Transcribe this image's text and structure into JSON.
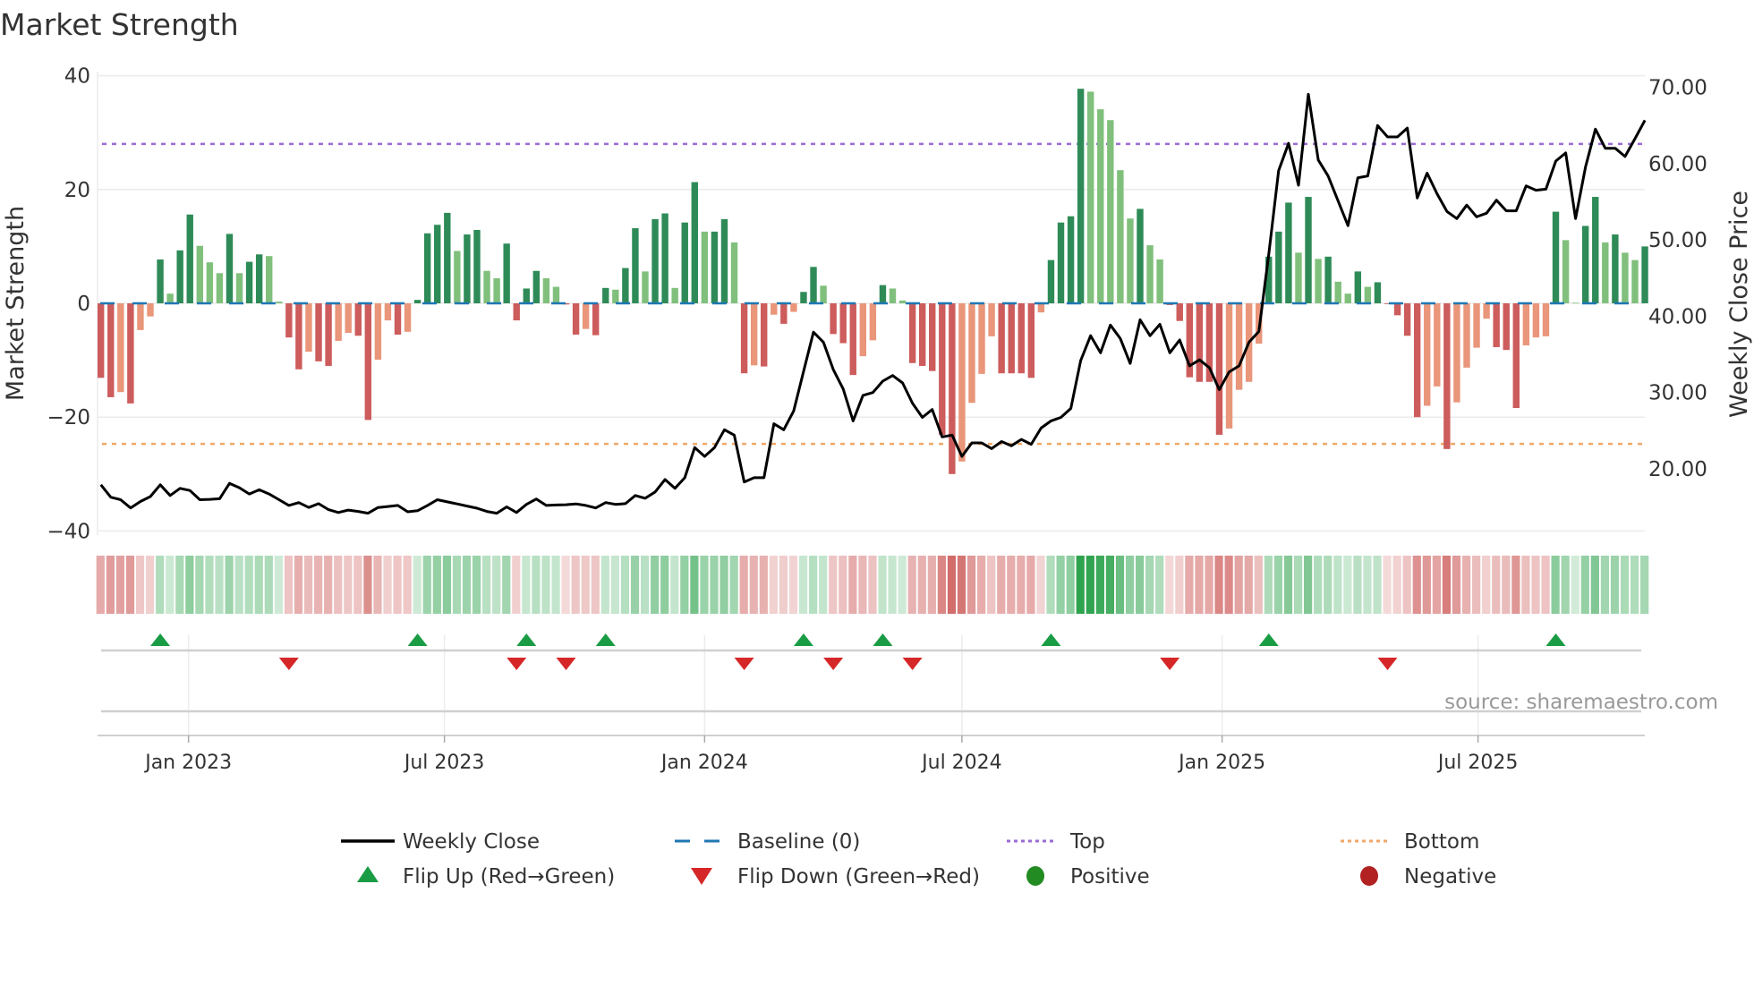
{
  "chart_data": {
    "type": "bar",
    "title": "Market Strength",
    "ylabel": "Market Strength",
    "y2label": "Weekly Close Price",
    "ylim": [
      -40,
      40
    ],
    "y2lim": [
      10.0,
      72.0
    ],
    "yticks": [
      "40",
      "20",
      "0",
      "−20",
      "−40"
    ],
    "ytick_values": [
      40,
      20,
      0,
      -20,
      -40
    ],
    "y2ticks": [
      "70.00",
      "60.00",
      "50.00",
      "40.00",
      "30.00",
      "20.00"
    ],
    "y2tick_values": [
      70,
      60,
      50,
      40,
      30,
      20
    ],
    "x_start": "2022-10-31",
    "x_step_days": 7,
    "xticks": [
      {
        "label": "Jan 2023",
        "date": "2023-01-01"
      },
      {
        "label": "Jul 2023",
        "date": "2023-07-01"
      },
      {
        "label": "Jan 2024",
        "date": "2024-01-01"
      },
      {
        "label": "Jul 2024",
        "date": "2024-07-01"
      },
      {
        "label": "Jan 2025",
        "date": "2025-01-01"
      },
      {
        "label": "Jul 2025",
        "date": "2025-07-01"
      }
    ],
    "top_level": 28,
    "bottom_level": -24.7,
    "baseline": 0,
    "strength": [
      -13.1,
      -16.5,
      -15.6,
      -17.6,
      -4.7,
      -2.3,
      7.7,
      1.7,
      9.3,
      15.6,
      10.1,
      7.2,
      5.3,
      12.2,
      5.3,
      7.3,
      8.6,
      8.3,
      0.3,
      -6.0,
      -11.6,
      -8.5,
      -10.2,
      -11.0,
      -6.6,
      -5.2,
      -5.7,
      -20.5,
      -9.9,
      -3.0,
      -5.5,
      -5.0,
      0.6,
      12.3,
      13.8,
      15.9,
      9.2,
      12.1,
      12.9,
      5.7,
      4.4,
      10.5,
      -3.0,
      2.6,
      5.7,
      4.4,
      2.9,
      -0.2,
      -5.5,
      -4.5,
      -5.6,
      2.7,
      2.4,
      6.2,
      13.2,
      5.6,
      14.8,
      15.8,
      2.7,
      14.2,
      21.3,
      12.6,
      12.6,
      14.8,
      10.7,
      -12.3,
      -10.9,
      -11.1,
      -2.0,
      -3.6,
      -1.5,
      2.0,
      6.4,
      3.1,
      -5.4,
      -7.0,
      -12.6,
      -9.3,
      -6.5,
      3.2,
      2.6,
      0.5,
      -10.5,
      -11.0,
      -11.9,
      -23.1,
      -30.0,
      -27.8,
      -17.5,
      -12.4,
      -5.8,
      -12.3,
      -12.3,
      -12.3,
      -13.1,
      -1.6,
      7.6,
      14.2,
      15.3,
      37.7,
      37.2,
      34.1,
      32.2,
      23.4,
      14.9,
      16.6,
      10.2,
      7.7,
      -0.3,
      -3.1,
      -13.0,
      -13.8,
      -13.8,
      -23.1,
      -22.0,
      -15.2,
      -13.8,
      -7.1,
      8.2,
      12.6,
      17.7,
      8.9,
      18.7,
      7.8,
      8.2,
      3.8,
      1.7,
      5.6,
      2.9,
      3.7,
      -0.1,
      -2.1,
      -5.7,
      -20.0,
      -18.0,
      -14.6,
      -25.6,
      -17.4,
      -11.3,
      -7.8,
      -2.7,
      -7.7,
      -8.2,
      -18.4,
      -7.4,
      -6.0,
      -5.8,
      16.1,
      11.1,
      0.1,
      13.6,
      18.7,
      10.7,
      12.1,
      8.9,
      7.6,
      10.0
    ],
    "weekly_close": [
      17.91,
      16.28,
      15.95,
      14.88,
      15.72,
      16.37,
      17.91,
      16.51,
      17.44,
      17.16,
      15.95,
      16.0,
      16.09,
      18.1,
      17.53,
      16.7,
      17.26,
      16.7,
      15.95,
      15.21,
      15.58,
      14.93,
      15.44,
      14.65,
      14.28,
      14.6,
      14.42,
      14.19,
      14.93,
      15.07,
      15.21,
      14.37,
      14.51,
      15.21,
      15.95,
      15.67,
      15.4,
      15.12,
      14.84,
      14.42,
      14.19,
      15.02,
      14.28,
      15.35,
      16.05,
      15.21,
      15.26,
      15.3,
      15.4,
      15.21,
      14.88,
      15.58,
      15.35,
      15.44,
      16.51,
      16.14,
      16.98,
      18.6,
      17.44,
      18.84,
      22.79,
      21.63,
      22.79,
      25.12,
      24.42,
      18.28,
      18.84,
      18.84,
      25.91,
      25.12,
      27.58,
      32.79,
      37.91,
      36.6,
      33.02,
      30.47,
      26.28,
      29.63,
      30.0,
      31.49,
      32.23,
      31.26,
      28.6,
      26.74,
      27.77,
      24.19,
      24.42,
      21.63,
      23.4,
      23.4,
      22.65,
      23.58,
      23.02,
      23.86,
      23.21,
      25.35,
      26.28,
      26.74,
      27.91,
      34.19,
      37.44,
      35.21,
      38.84,
      37.07,
      33.81,
      39.53,
      37.44,
      38.93,
      35.21,
      36.88,
      33.49,
      34.28,
      33.26,
      30.37,
      32.7,
      33.49,
      36.6,
      38.0,
      48.14,
      59.07,
      62.65,
      57.16,
      69.07,
      60.47,
      58.37,
      55.12,
      51.86,
      58.14,
      58.37,
      64.98,
      63.49,
      63.49,
      64.65,
      55.49,
      58.74,
      56.05,
      53.72,
      52.79,
      54.56,
      53.02,
      53.49,
      55.21,
      53.81,
      53.81,
      57.07,
      56.51,
      56.65,
      60.33,
      61.4,
      52.79,
      59.53,
      64.51,
      62.0,
      62.0,
      60.93,
      63.26,
      65.67
    ],
    "legend": [
      {
        "label": "Weekly Close",
        "symbol": "solid-line",
        "color": "#000000"
      },
      {
        "label": "Baseline (0)",
        "symbol": "dashed-line",
        "color": "#1f77b4"
      },
      {
        "label": "Top",
        "symbol": "dotted-line",
        "color": "#9b6bd6"
      },
      {
        "label": "Bottom",
        "symbol": "dotted-line",
        "color": "#f0a868"
      },
      {
        "label": "Flip Up (Red→Green)",
        "symbol": "triangle-up",
        "color": "#1a9c45"
      },
      {
        "label": "Flip Down (Green→Red)",
        "symbol": "triangle-down",
        "color": "#d62728"
      },
      {
        "label": "Positive",
        "symbol": "circle",
        "color": "#228b22"
      },
      {
        "label": "Negative",
        "symbol": "circle",
        "color": "#b22222"
      }
    ],
    "legend_position": "bottom",
    "grid": true,
    "colors": {
      "pos_strong": "#2e8b57",
      "pos_weak": "#80c07c",
      "neg_strong": "#cd5c5c",
      "neg_weak": "#e9967a",
      "heat_pos": "#2ca24c",
      "heat_neg": "#c9514f"
    },
    "source": "source: sharemaestro.com"
  }
}
